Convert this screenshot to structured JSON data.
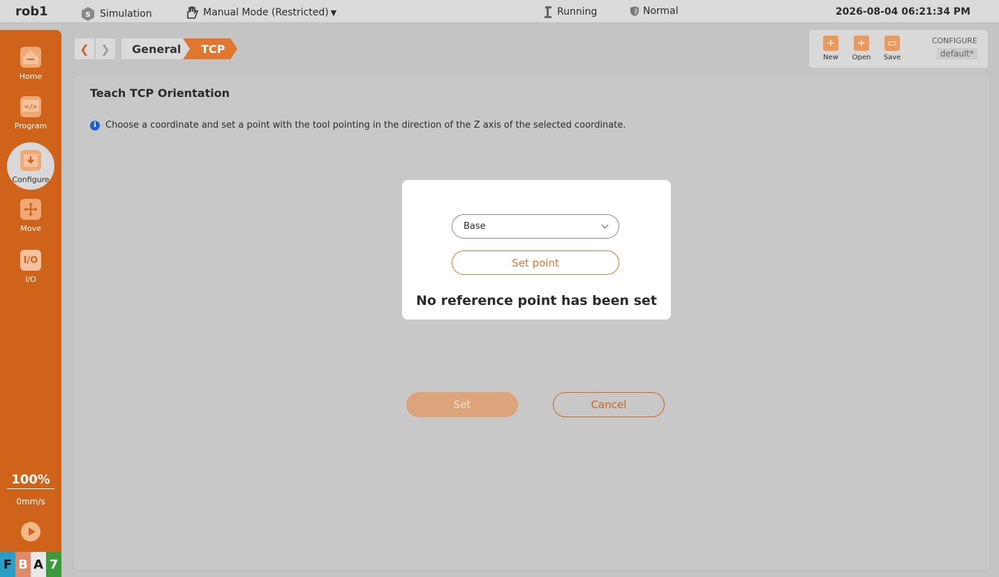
{
  "topbar": {
    "robot_name": "rob1",
    "simulation_label": "Simulation",
    "mode_label": "Manual Mode (Restricted)",
    "run_status": "Running",
    "safety_status": "Normal",
    "datetime": "2026-08-04 06:21:34 PM"
  },
  "sidebar": {
    "items": [
      {
        "label": "Home",
        "icon": "home-icon"
      },
      {
        "label": "Program",
        "icon": "code-icon"
      },
      {
        "label": "Configure",
        "icon": "configure-icon"
      },
      {
        "label": "Move",
        "icon": "move-icon"
      },
      {
        "label": "I/O",
        "icon": "io-icon"
      }
    ],
    "active": "Configure",
    "speed_percent": "100%",
    "speed_mm": "0mm/s",
    "status_letters": [
      "F",
      "B",
      "A",
      "7"
    ]
  },
  "breadcrumb": {
    "items": [
      "General",
      "TCP"
    ]
  },
  "config": {
    "new_label": "New",
    "open_label": "Open",
    "save_label": "Save",
    "title": "CONFIGURE",
    "file": "default*"
  },
  "main": {
    "title": "Teach TCP Orientation",
    "info": "Choose a coordinate and set a point with the tool pointing in the direction of the Z axis of the selected coordinate.",
    "coordinate_selected": "Base",
    "set_point_label": "Set point",
    "status_message": "No reference point has been set",
    "set_label": "Set",
    "cancel_label": "Cancel"
  },
  "colors": {
    "accent": "#cf631a",
    "accent_light": "#e0762f",
    "info_blue": "#1a5fd0"
  }
}
